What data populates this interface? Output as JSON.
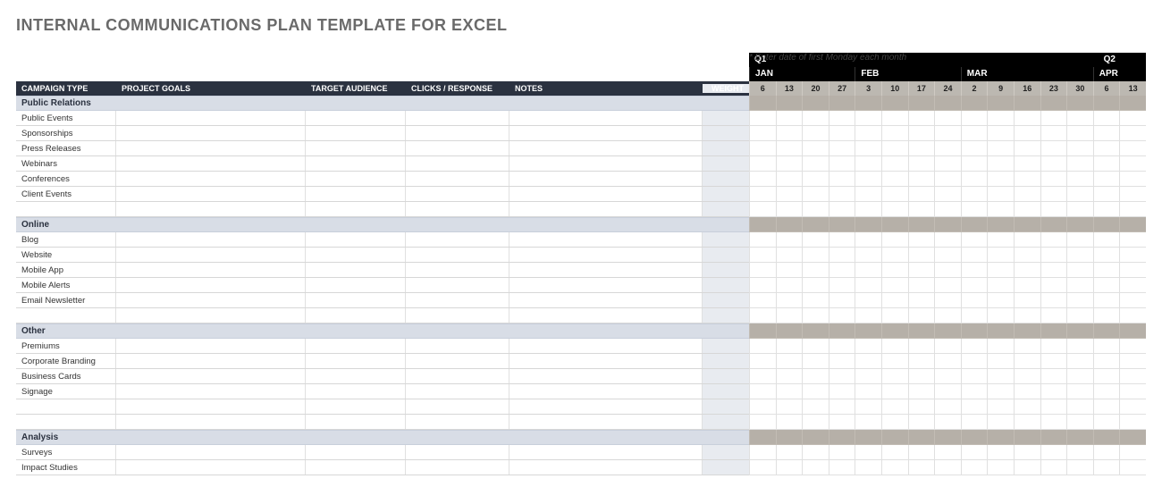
{
  "page_title": "INTERNAL COMMUNICATIONS PLAN TEMPLATE FOR EXCEL",
  "helper_text": "* Enter date of first Monday each month",
  "columns": {
    "campaign": "CAMPAIGN TYPE",
    "goals": "PROJECT GOALS",
    "target": "TARGET AUDIENCE",
    "clicks": "CLICKS / RESPONSE",
    "notes": "NOTES",
    "weight": "WEIGHT"
  },
  "quarters": [
    {
      "label": "Q1",
      "span": 15
    },
    {
      "label": "Q2",
      "span": 2
    }
  ],
  "months": [
    {
      "label": "JAN",
      "days": [
        "6",
        "13",
        "20",
        "27"
      ]
    },
    {
      "label": "FEB",
      "days": [
        "3",
        "10",
        "17",
        "24"
      ]
    },
    {
      "label": "MAR",
      "days": [
        "2",
        "9",
        "16",
        "23",
        "30"
      ]
    },
    {
      "label": "APR",
      "days": [
        "6",
        "13"
      ]
    }
  ],
  "sections": [
    {
      "name": "Public Relations",
      "rows": [
        "Public Events",
        "Sponsorships",
        "Press Releases",
        "Webinars",
        "Conferences",
        "Client Events",
        ""
      ]
    },
    {
      "name": "Online",
      "rows": [
        "Blog",
        "Website",
        "Mobile App",
        "Mobile Alerts",
        "Email Newsletter",
        ""
      ]
    },
    {
      "name": "Other",
      "rows": [
        "Premiums",
        "Corporate Branding",
        "Business Cards",
        "Signage",
        "",
        ""
      ]
    },
    {
      "name": "Analysis",
      "rows": [
        "Surveys",
        "Impact Studies"
      ]
    }
  ]
}
